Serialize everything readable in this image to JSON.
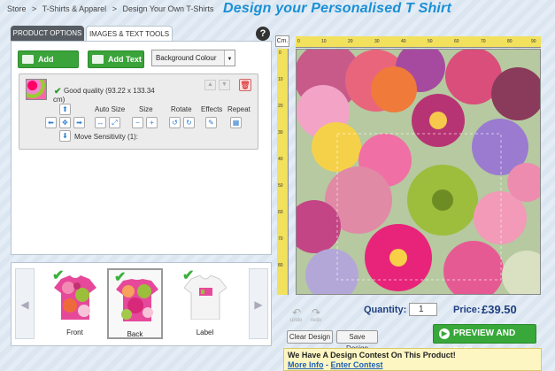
{
  "breadcrumb": {
    "items": [
      "Store",
      ">",
      "T-Shirts & Apparel",
      ">",
      "Design Your Own T-Shirts"
    ]
  },
  "page_title": "Design your Personalised T Shirt",
  "tabs": [
    {
      "label": "PRODUCT OPTIONS",
      "active": false
    },
    {
      "label": "IMAGES & TEXT TOOLS",
      "active": true
    }
  ],
  "help_label": "?",
  "toolbar": {
    "add_image_label": "Add Image",
    "add_text_label": "Add Text",
    "background_select_value": "Background Colour"
  },
  "item": {
    "quality_text": "Good quality (93.22 x 133.34 cm)",
    "auto_size_label": "Auto Size",
    "size_label": "Size",
    "rotate_label": "Rotate",
    "effects_label": "Effects",
    "repeat_label": "Repeat",
    "move_sensitivity_label": "Move Sensitivity (",
    "move_sensitivity_value": "1",
    "move_sensitivity_suffix": "):"
  },
  "views": [
    {
      "label": "Front",
      "checked": true
    },
    {
      "label": "Back",
      "checked": true,
      "selected": true
    },
    {
      "label": "Label",
      "checked": true
    }
  ],
  "ruler": {
    "unit": "Cm.",
    "top_ticks": [
      "0",
      "10",
      "20",
      "30",
      "40",
      "50",
      "60",
      "70",
      "80",
      "90"
    ],
    "left_ticks": [
      "0",
      "10",
      "20",
      "30",
      "40",
      "50",
      "60",
      "70",
      "80"
    ]
  },
  "undo_label": "undo",
  "redo_label": "redo",
  "quantity_label": "Quantity:",
  "quantity_value": "1",
  "price_label": "Price:",
  "price_value": "£39.50",
  "clear_design_label": "Clear Design",
  "save_design_label": "Save Design",
  "preview_buy_label": "PREVIEW AND BUY",
  "contest": {
    "title": "We Have A Design Contest On This Product!",
    "more_info": "More Info",
    "separator": " - ",
    "enter_contest": "Enter Contest"
  },
  "colors": {
    "accent_green": "#38a83a",
    "title_blue": "#1a8fd6",
    "ruler_yellow": "#f2e15d",
    "price_blue": "#1f3f80"
  }
}
